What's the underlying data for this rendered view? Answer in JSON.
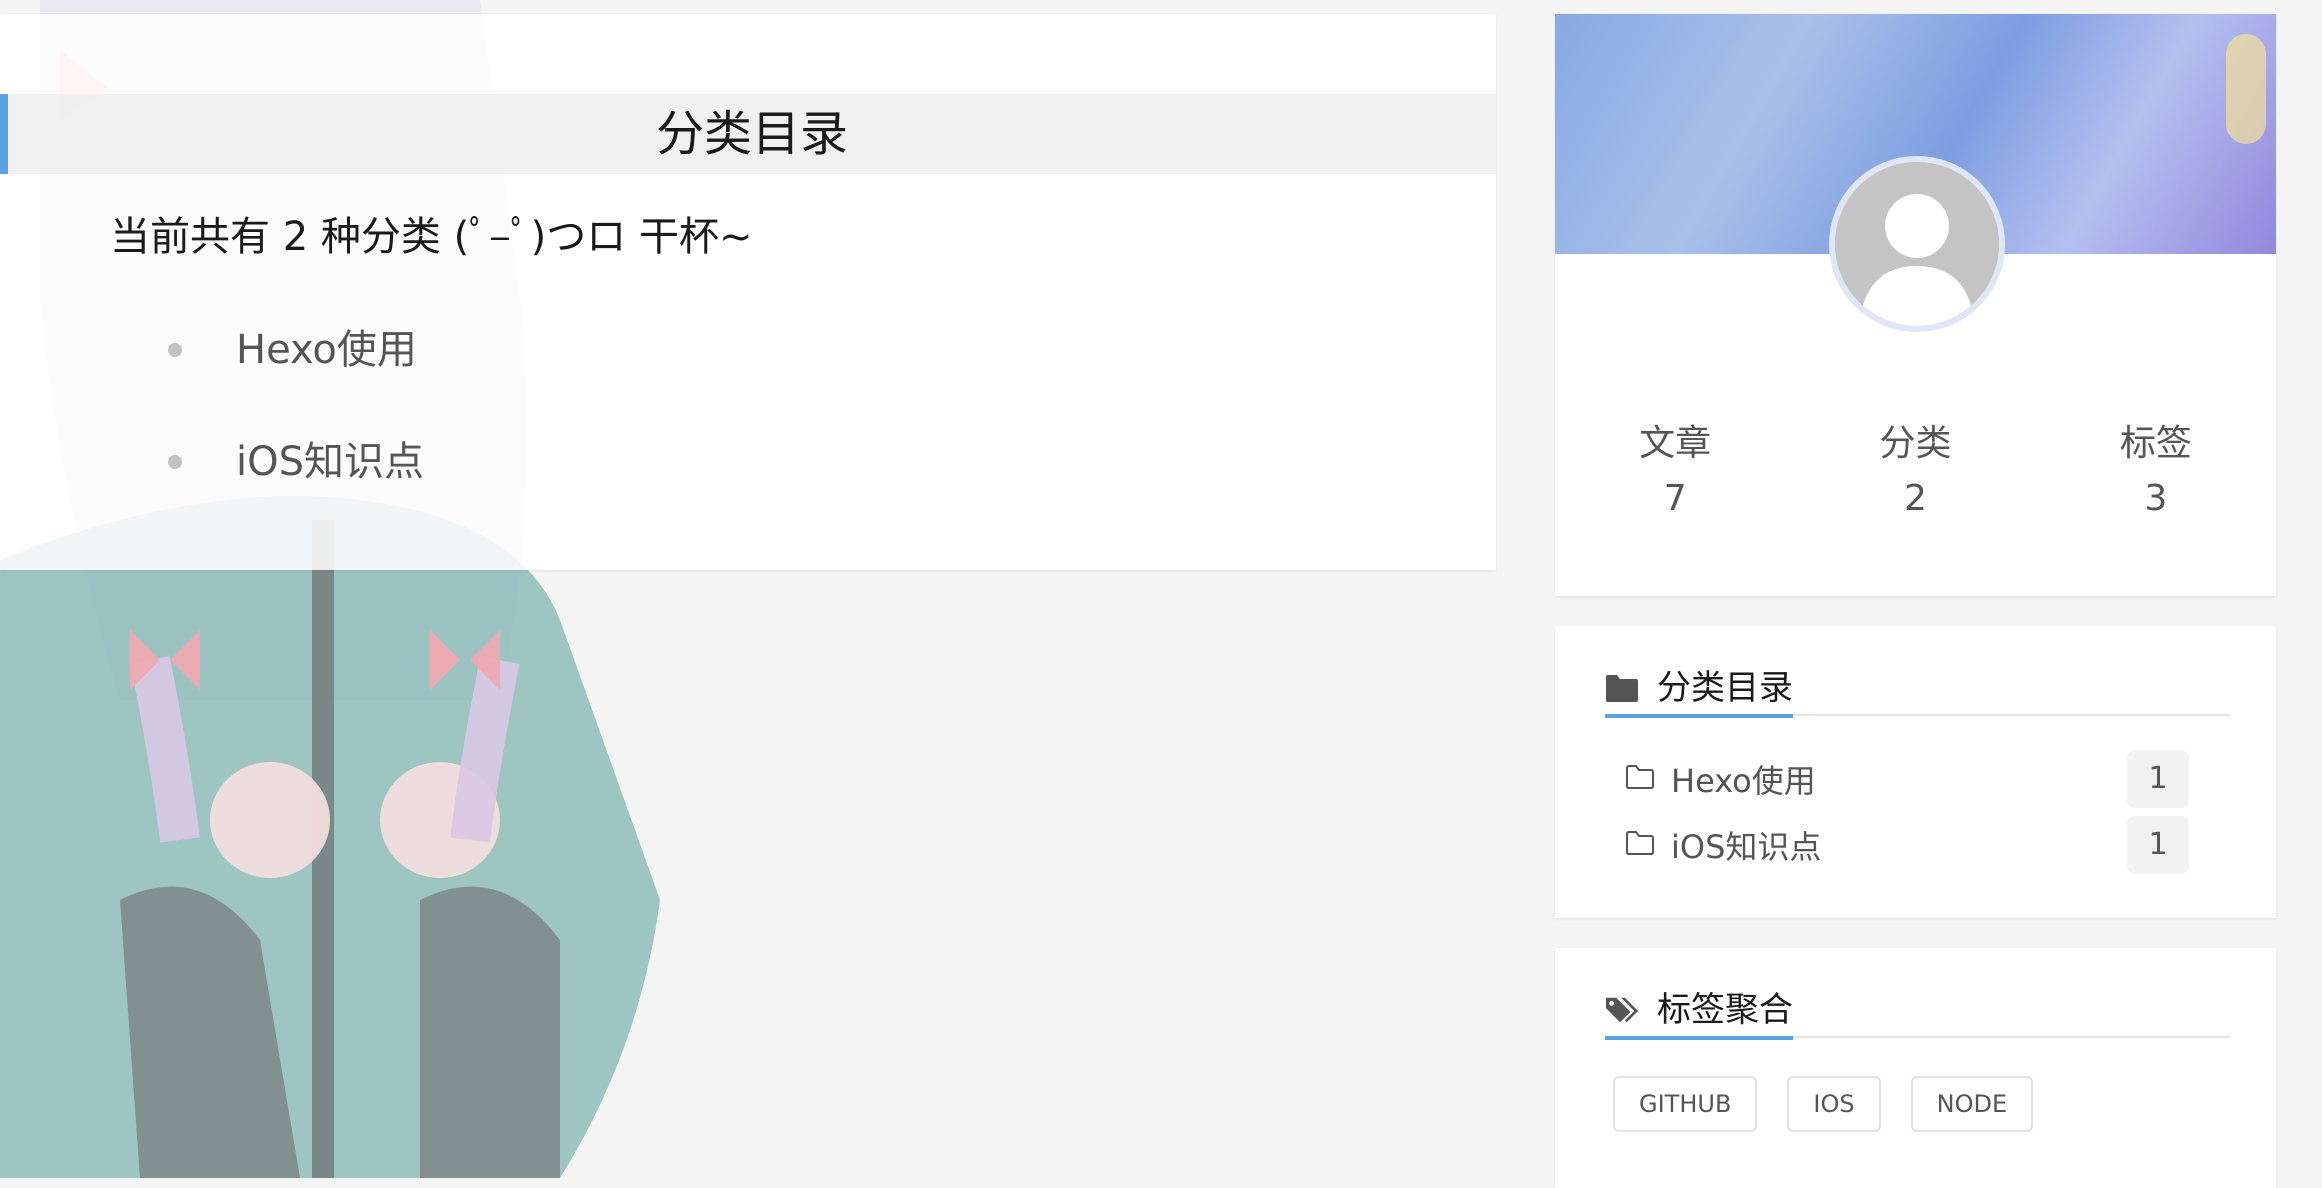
{
  "main": {
    "heading": "分类目录",
    "summary": "当前共有 2 种分类 (ﾟ–ﾟ)つロ 干杯~",
    "categories": [
      {
        "label": "Hexo使用"
      },
      {
        "label": "iOS知识点"
      }
    ]
  },
  "profile": {
    "stats": [
      {
        "label": "文章",
        "value": "7"
      },
      {
        "label": "分类",
        "value": "2"
      },
      {
        "label": "标签",
        "value": "3"
      }
    ]
  },
  "sidebar_categories": {
    "title": "分类目录",
    "icon": "folder-icon",
    "items": [
      {
        "label": "Hexo使用",
        "count": "1"
      },
      {
        "label": "iOS知识点",
        "count": "1"
      }
    ]
  },
  "sidebar_tags": {
    "title": "标签聚合",
    "icon": "tags-icon",
    "tags": [
      "GITHUB",
      "IOS",
      "NODE"
    ]
  },
  "colors": {
    "accent": "#5aa2e5",
    "background": "#f4f4f4"
  }
}
